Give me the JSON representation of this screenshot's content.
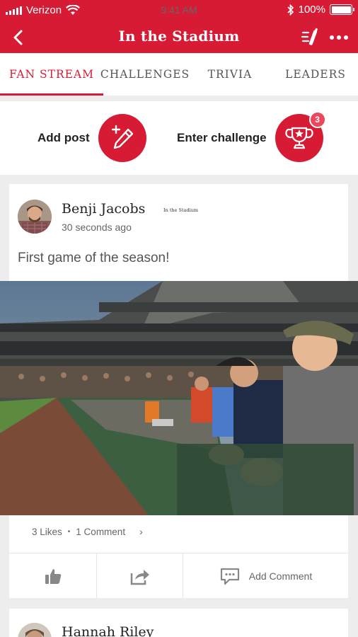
{
  "status_bar": {
    "carrier": "Verizon",
    "time": "9:41 AM",
    "battery": "100%"
  },
  "header": {
    "title": "In the Stadium",
    "icons": [
      "back-chevron-icon",
      "cheer-bottle-icon",
      "more-dots-icon"
    ]
  },
  "tabs": [
    {
      "label": "FAN STREAM",
      "active": true
    },
    {
      "label": "CHALLENGES",
      "active": false
    },
    {
      "label": "TRIVIA",
      "active": false
    },
    {
      "label": "LEADERS",
      "active": false
    }
  ],
  "actions": {
    "add_post_label": "Add post",
    "enter_challenge_label": "Enter challenge",
    "challenge_badge_count": "3"
  },
  "post": {
    "author": "Benji Jacobs",
    "location": "In the Stadium",
    "time_ago": "30 seconds ago",
    "text": "First game of the season!",
    "likes": "3 Likes",
    "comments": "1 Comment",
    "add_comment_label": "Add Comment"
  },
  "next_post": {
    "author": "Hannah Riley"
  },
  "colors": {
    "brand_red": "#d81b34",
    "badge_red": "#e9485d",
    "background": "#ededed"
  }
}
